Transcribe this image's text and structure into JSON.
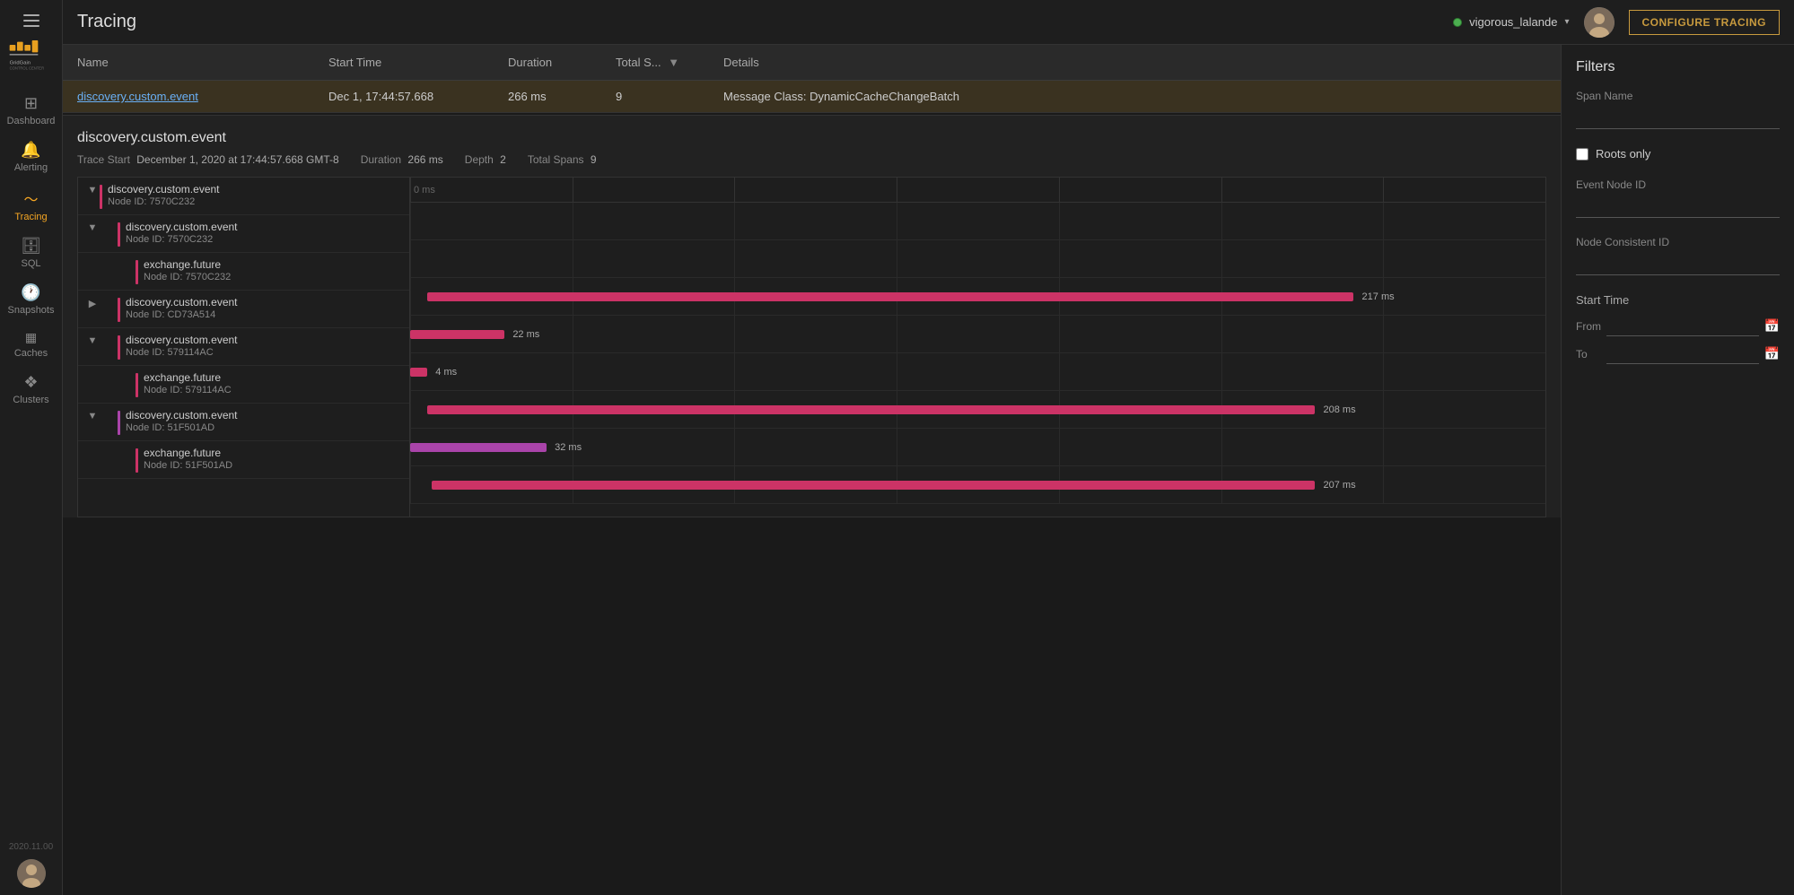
{
  "app": {
    "version": "2020.11.00",
    "logo_text": "GridGain\nCONTROL CENTER"
  },
  "sidebar": {
    "items": [
      {
        "id": "dashboard",
        "label": "Dashboard",
        "icon": "⊞"
      },
      {
        "id": "alerting",
        "label": "Alerting",
        "icon": "🔔"
      },
      {
        "id": "tracing",
        "label": "Tracing",
        "icon": "≈",
        "active": true
      },
      {
        "id": "sql",
        "label": "SQL",
        "icon": "🗄"
      },
      {
        "id": "snapshots",
        "label": "Snapshots",
        "icon": "🕐"
      },
      {
        "id": "caches",
        "label": "Caches",
        "icon": "▦"
      },
      {
        "id": "clusters",
        "label": "Clusters",
        "icon": "❖"
      }
    ]
  },
  "topbar": {
    "title": "Tracing",
    "configure_btn": "CONFIGURE TRACING",
    "user": {
      "name": "vigorous_lalande",
      "status": "online"
    }
  },
  "table": {
    "columns": [
      {
        "id": "name",
        "label": "Name"
      },
      {
        "id": "start_time",
        "label": "Start Time"
      },
      {
        "id": "duration",
        "label": "Duration"
      },
      {
        "id": "total_spans",
        "label": "Total S...",
        "sorted": true,
        "sort_dir": "desc"
      },
      {
        "id": "details",
        "label": "Details"
      }
    ],
    "rows": [
      {
        "name": "discovery.custom.event",
        "start_time": "Dec 1, 17:44:57.668",
        "duration": "266 ms",
        "total_spans": "9",
        "details": "Message Class: DynamicCacheChangeBatch",
        "selected": true
      }
    ]
  },
  "detail": {
    "title": "discovery.custom.event",
    "trace_start_label": "Trace Start",
    "trace_start_value": "December 1, 2020 at 17:44:57.668 GMT-8",
    "duration_label": "Duration",
    "duration_value": "266 ms",
    "depth_label": "Depth",
    "depth_value": "2",
    "total_spans_label": "Total Spans",
    "total_spans_value": "9"
  },
  "spans": [
    {
      "id": "s1",
      "name": "discovery.custom.event",
      "node_id": "7570C232",
      "indent": 0,
      "color": "#cc3366",
      "collapsed": false,
      "toggle": "▼",
      "bar_left_pct": 0,
      "bar_width_pct": 0,
      "label": "",
      "label_right": false
    },
    {
      "id": "s2",
      "name": "discovery.custom.event",
      "node_id": "7570C232",
      "indent": 20,
      "color": "#cc3366",
      "collapsed": false,
      "toggle": "▼",
      "bar_left_pct": 0,
      "bar_width_pct": 0,
      "label": "",
      "label_right": false
    },
    {
      "id": "s3",
      "name": "exchange.future",
      "node_id": "7570C232",
      "indent": 40,
      "color": "#cc3366",
      "collapsed": false,
      "toggle": "",
      "bar_left_pct": 1.5,
      "bar_width_pct": 81.6,
      "label": "217 ms",
      "label_right": true
    },
    {
      "id": "s4",
      "name": "discovery.custom.event",
      "node_id": "CD73A514",
      "indent": 20,
      "color": "#cc3366",
      "collapsed": true,
      "toggle": "▶",
      "bar_left_pct": 0,
      "bar_width_pct": 8.3,
      "label": "22 ms",
      "label_right": false
    },
    {
      "id": "s5",
      "name": "discovery.custom.event",
      "node_id": "579114AC",
      "indent": 20,
      "color": "#cc3366",
      "collapsed": false,
      "toggle": "▼",
      "bar_left_pct": 0,
      "bar_width_pct": 1.5,
      "label": "4 ms",
      "label_right": false
    },
    {
      "id": "s6",
      "name": "exchange.future",
      "node_id": "579114AC",
      "indent": 40,
      "color": "#cc3366",
      "collapsed": false,
      "toggle": "",
      "bar_left_pct": 1.5,
      "bar_width_pct": 78.2,
      "label": "208 ms",
      "label_right": true
    },
    {
      "id": "s7",
      "name": "discovery.custom.event",
      "node_id": "51F501AD",
      "indent": 20,
      "color": "#aa44aa",
      "collapsed": false,
      "toggle": "▼",
      "bar_left_pct": 0,
      "bar_width_pct": 12.0,
      "label": "32 ms",
      "label_right": false
    },
    {
      "id": "s8",
      "name": "exchange.future",
      "node_id": "51F501AD",
      "indent": 40,
      "color": "#cc3366",
      "collapsed": false,
      "toggle": "",
      "bar_left_pct": 1.9,
      "bar_width_pct": 77.8,
      "label": "207 ms",
      "label_right": true
    }
  ],
  "timeline": {
    "ticks": [
      {
        "label": "0 ms",
        "pct": 0
      },
      {
        "label": "",
        "pct": 14.3
      },
      {
        "label": "",
        "pct": 28.6
      },
      {
        "label": "",
        "pct": 42.9
      },
      {
        "label": "",
        "pct": 57.1
      },
      {
        "label": "",
        "pct": 71.4
      },
      {
        "label": "",
        "pct": 85.7
      },
      {
        "label": "",
        "pct": 100
      }
    ]
  },
  "filters": {
    "title": "Filters",
    "span_name_label": "Span Name",
    "span_name_placeholder": "",
    "roots_only_label": "Roots only",
    "event_node_id_label": "Event Node ID",
    "event_node_id_placeholder": "",
    "node_consistent_id_label": "Node Consistent ID",
    "node_consistent_id_placeholder": "",
    "start_time_section": "Start Time",
    "from_label": "From",
    "to_label": "To"
  }
}
